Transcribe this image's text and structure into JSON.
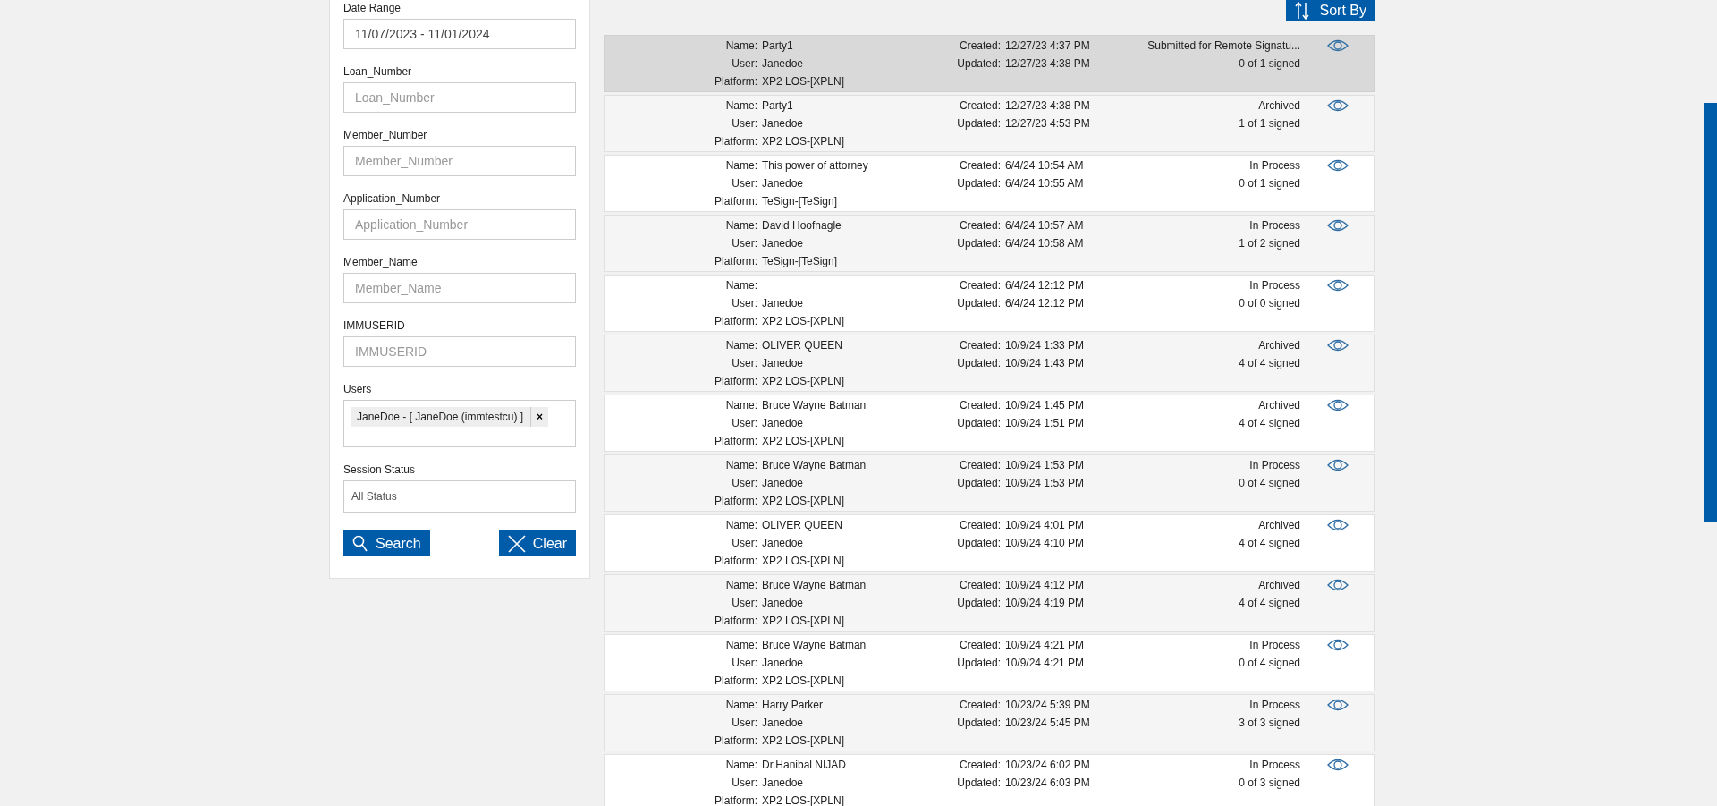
{
  "filters": [
    {
      "kind": "text",
      "label": "Date Range",
      "value": "11/07/2023 - 11/01/2024"
    },
    {
      "kind": "text",
      "label": "Loan_Number",
      "placeholder": "Loan_Number"
    },
    {
      "kind": "text",
      "label": "Member_Number",
      "placeholder": "Member_Number"
    },
    {
      "kind": "text",
      "label": "Application_Number",
      "placeholder": "Application_Number"
    },
    {
      "kind": "text",
      "label": "Member_Name",
      "placeholder": "Member_Name"
    },
    {
      "kind": "text",
      "label": "IMMUSERID",
      "placeholder": "IMMUSERID"
    },
    {
      "kind": "tags",
      "label": "Users",
      "tags": [
        {
          "text": "JaneDoe - [ JaneDoe (immtestcu) ]",
          "remove": "×"
        }
      ]
    },
    {
      "kind": "select",
      "label": "Session Status",
      "value": "All Status"
    }
  ],
  "buttons": [
    {
      "kind": "search",
      "label": "Search"
    },
    {
      "kind": "clear",
      "label": "Clear"
    }
  ],
  "sort_button": {
    "label": "Sort By"
  },
  "sessions": [
    {
      "selected": true,
      "name_label": "Name:",
      "name": "Party1",
      "user_label": "User:",
      "user": "Janedoe",
      "platform_label": "Platform:",
      "platform": "XP2 LOS-[XPLN]",
      "created_label": "Created:",
      "created": "12/27/23 4:37 PM",
      "updated_label": "Updated:",
      "updated": "12/27/23 4:38 PM",
      "status": "Submitted for Remote Signatu...",
      "signed": "0 of 1 signed"
    },
    {
      "selected": false,
      "name_label": "Name:",
      "name": "Party1",
      "user_label": "User:",
      "user": "Janedoe",
      "platform_label": "Platform:",
      "platform": "XP2 LOS-[XPLN]",
      "created_label": "Created:",
      "created": "12/27/23 4:38 PM",
      "updated_label": "Updated:",
      "updated": "12/27/23 4:53 PM",
      "status": "Archived",
      "signed": "1 of 1 signed"
    },
    {
      "selected": false,
      "name_label": "Name:",
      "name": "This power of attorney",
      "user_label": "User:",
      "user": "Janedoe",
      "platform_label": "Platform:",
      "platform": "TeSign-[TeSign]",
      "created_label": "Created:",
      "created": "6/4/24 10:54 AM",
      "updated_label": "Updated:",
      "updated": "6/4/24 10:55 AM",
      "status": "In Process",
      "signed": "0 of 1 signed"
    },
    {
      "selected": false,
      "name_label": "Name:",
      "name": "David Hoofnagle",
      "user_label": "User:",
      "user": "Janedoe",
      "platform_label": "Platform:",
      "platform": "TeSign-[TeSign]",
      "created_label": "Created:",
      "created": "6/4/24 10:57 AM",
      "updated_label": "Updated:",
      "updated": "6/4/24 10:58 AM",
      "status": "In Process",
      "signed": "1 of 2 signed"
    },
    {
      "selected": false,
      "name_label": "Name:",
      "user_label": "User:",
      "user": "Janedoe",
      "platform_label": "Platform:",
      "platform": "XP2 LOS-[XPLN]",
      "created_label": "Created:",
      "created": "6/4/24 12:12 PM",
      "updated_label": "Updated:",
      "updated": "6/4/24 12:12 PM",
      "status": "In Process",
      "signed": "0 of 0 signed"
    },
    {
      "selected": false,
      "name_label": "Name:",
      "name": "OLIVER QUEEN",
      "user_label": "User:",
      "user": "Janedoe",
      "platform_label": "Platform:",
      "platform": "XP2 LOS-[XPLN]",
      "created_label": "Created:",
      "created": "10/9/24 1:33 PM",
      "updated_label": "Updated:",
      "updated": "10/9/24 1:43 PM",
      "status": "Archived",
      "signed": "4 of 4 signed"
    },
    {
      "selected": false,
      "name_label": "Name:",
      "name": "Bruce Wayne Batman",
      "user_label": "User:",
      "user": "Janedoe",
      "platform_label": "Platform:",
      "platform": "XP2 LOS-[XPLN]",
      "created_label": "Created:",
      "created": "10/9/24 1:45 PM",
      "updated_label": "Updated:",
      "updated": "10/9/24 1:51 PM",
      "status": "Archived",
      "signed": "4 of 4 signed"
    },
    {
      "selected": false,
      "name_label": "Name:",
      "name": "Bruce Wayne Batman",
      "user_label": "User:",
      "user": "Janedoe",
      "platform_label": "Platform:",
      "platform": "XP2 LOS-[XPLN]",
      "created_label": "Created:",
      "created": "10/9/24 1:53 PM",
      "updated_label": "Updated:",
      "updated": "10/9/24 1:53 PM",
      "status": "In Process",
      "signed": "0 of 4 signed"
    },
    {
      "selected": false,
      "name_label": "Name:",
      "name": "OLIVER QUEEN",
      "user_label": "User:",
      "user": "Janedoe",
      "platform_label": "Platform:",
      "platform": "XP2 LOS-[XPLN]",
      "created_label": "Created:",
      "created": "10/9/24 4:01 PM",
      "updated_label": "Updated:",
      "updated": "10/9/24 4:10 PM",
      "status": "Archived",
      "signed": "4 of 4 signed"
    },
    {
      "selected": false,
      "name_label": "Name:",
      "name": "Bruce Wayne Batman",
      "user_label": "User:",
      "user": "Janedoe",
      "platform_label": "Platform:",
      "platform": "XP2 LOS-[XPLN]",
      "created_label": "Created:",
      "created": "10/9/24 4:12 PM",
      "updated_label": "Updated:",
      "updated": "10/9/24 4:19 PM",
      "status": "Archived",
      "signed": "4 of 4 signed"
    },
    {
      "selected": false,
      "name_label": "Name:",
      "name": "Bruce Wayne Batman",
      "user_label": "User:",
      "user": "Janedoe",
      "platform_label": "Platform:",
      "platform": "XP2 LOS-[XPLN]",
      "created_label": "Created:",
      "created": "10/9/24 4:21 PM",
      "updated_label": "Updated:",
      "updated": "10/9/24 4:21 PM",
      "status": "In Process",
      "signed": "0 of 4 signed"
    },
    {
      "selected": false,
      "name_label": "Name:",
      "name": "Harry Parker",
      "user_label": "User:",
      "user": "Janedoe",
      "platform_label": "Platform:",
      "platform": "XP2 LOS-[XPLN]",
      "created_label": "Created:",
      "created": "10/23/24 5:39 PM",
      "updated_label": "Updated:",
      "updated": "10/23/24 5:45 PM",
      "status": "In Process",
      "signed": "3 of 3 signed"
    },
    {
      "selected": false,
      "name_label": "Name:",
      "name": "Dr.Hanibal NIJAD",
      "user_label": "User:",
      "user": "Janedoe",
      "platform_label": "Platform:",
      "platform": "XP2 LOS-[XPLN]",
      "created_label": "Created:",
      "created": "10/23/24 6:02 PM",
      "updated_label": "Updated:",
      "updated": "10/23/24 6:03 PM",
      "status": "In Process",
      "signed": "0 of 3 signed"
    }
  ]
}
